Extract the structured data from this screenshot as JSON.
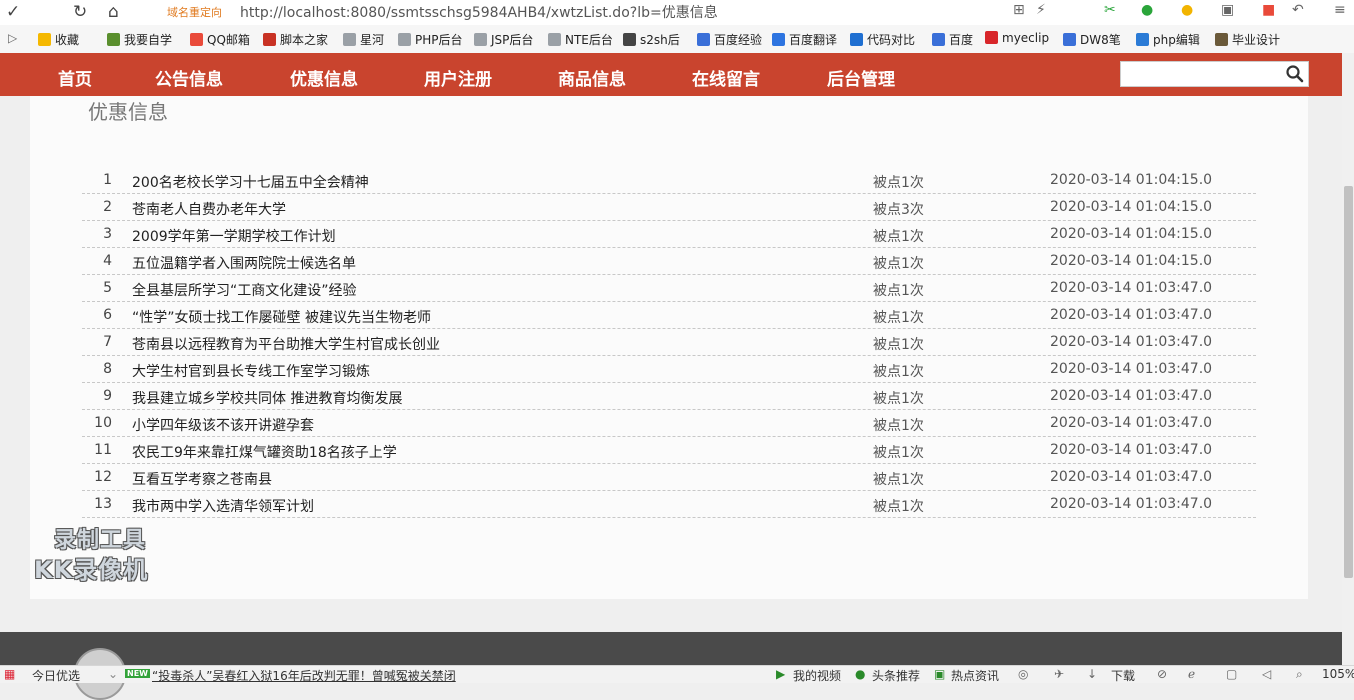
{
  "browser": {
    "redirect_label": "域名重定向",
    "url": "http://localhost:8080/ssmtsschsg5984AHB4/xwtzList.do?lb=优惠信息",
    "bookmarks": [
      {
        "label": "收藏",
        "icon": "star-icon",
        "color": "#f5b800"
      },
      {
        "label": "我要自学",
        "icon": "bookmark-icon",
        "color": "#5a8f2e"
      },
      {
        "label": "QQ邮箱",
        "icon": "qqmail-icon",
        "color": "#e94a3a"
      },
      {
        "label": "脚本之家",
        "icon": "jb51-icon",
        "color": "#c83224"
      },
      {
        "label": "星河",
        "icon": "page-icon",
        "color": "#9aa0a6"
      },
      {
        "label": "PHP后台",
        "icon": "page-icon",
        "color": "#9aa0a6"
      },
      {
        "label": "JSP后台",
        "icon": "page-icon",
        "color": "#9aa0a6"
      },
      {
        "label": "NTE后台",
        "icon": "page-icon",
        "color": "#9aa0a6"
      },
      {
        "label": "s2sh后",
        "icon": "image-icon",
        "color": "#444444"
      },
      {
        "label": "百度经验",
        "icon": "baidu-paw-icon",
        "color": "#3a6fd8"
      },
      {
        "label": "百度翻译",
        "icon": "translate-icon",
        "color": "#2d74e0"
      },
      {
        "label": "代码对比",
        "icon": "compare-icon",
        "color": "#1f6fd1"
      },
      {
        "label": "百度",
        "icon": "baidu-paw-icon",
        "color": "#3a6fd8"
      },
      {
        "label": "myeclip",
        "icon": "c-icon",
        "color": "#d8262a"
      },
      {
        "label": "DW8笔",
        "icon": "baidu-paw-icon",
        "color": "#3a6fd8"
      },
      {
        "label": "php编辑",
        "icon": "k-icon",
        "color": "#2b7bd6"
      },
      {
        "label": "毕业设计",
        "icon": "avatar-icon",
        "color": "#6b5a3a"
      }
    ]
  },
  "nav": {
    "items": [
      "首页",
      "公告信息",
      "优惠信息",
      "用户注册",
      "商品信息",
      "在线留言",
      "后台管理"
    ],
    "search_placeholder": ""
  },
  "section_title": "优惠信息",
  "rows": [
    {
      "num": "1",
      "title": "200名老校长学习十七届五中全会精神",
      "clicks": "被点1次",
      "date": "2020-03-14 01:04:15.0"
    },
    {
      "num": "2",
      "title": "苍南老人自费办老年大学",
      "clicks": "被点3次",
      "date": "2020-03-14 01:04:15.0"
    },
    {
      "num": "3",
      "title": "2009学年第一学期学校工作计划",
      "clicks": "被点1次",
      "date": "2020-03-14 01:04:15.0"
    },
    {
      "num": "4",
      "title": "五位温籍学者入围两院院士候选名单",
      "clicks": "被点1次",
      "date": "2020-03-14 01:04:15.0"
    },
    {
      "num": "5",
      "title": "全县基层所学习“工商文化建设”经验",
      "clicks": "被点1次",
      "date": "2020-03-14 01:03:47.0"
    },
    {
      "num": "6",
      "title": "“性学”女硕士找工作屡碰壁 被建议先当生物老师",
      "clicks": "被点1次",
      "date": "2020-03-14 01:03:47.0"
    },
    {
      "num": "7",
      "title": "苍南县以远程教育为平台助推大学生村官成长创业",
      "clicks": "被点1次",
      "date": "2020-03-14 01:03:47.0"
    },
    {
      "num": "8",
      "title": "大学生村官到县长专线工作室学习锻炼",
      "clicks": "被点1次",
      "date": "2020-03-14 01:03:47.0"
    },
    {
      "num": "9",
      "title": "我县建立城乡学校共同体 推进教育均衡发展",
      "clicks": "被点1次",
      "date": "2020-03-14 01:03:47.0"
    },
    {
      "num": "10",
      "title": "小学四年级该不该开讲避孕套",
      "clicks": "被点1次",
      "date": "2020-03-14 01:03:47.0"
    },
    {
      "num": "11",
      "title": "农民工9年来靠扛煤气罐资助18名孩子上学",
      "clicks": "被点1次",
      "date": "2020-03-14 01:03:47.0"
    },
    {
      "num": "12",
      "title": "互看互学考察之苍南县",
      "clicks": "被点1次",
      "date": "2020-03-14 01:03:47.0"
    },
    {
      "num": "13",
      "title": "我市两中学入选清华领军计划",
      "clicks": "被点1次",
      "date": "2020-03-14 01:03:47.0"
    }
  ],
  "watermark": {
    "line1": "录制工具",
    "line2": "KK录像机"
  },
  "statusbar": {
    "today": "今日优选",
    "new_badge": "NEW",
    "headline": "“投毒杀人”吴春红入狱16年后改判无罪！曾喊冤被关禁闭",
    "video": "我的视频",
    "headlines": "头条推荐",
    "hot": "热点资讯",
    "download": "下载",
    "zoom": "105%"
  }
}
